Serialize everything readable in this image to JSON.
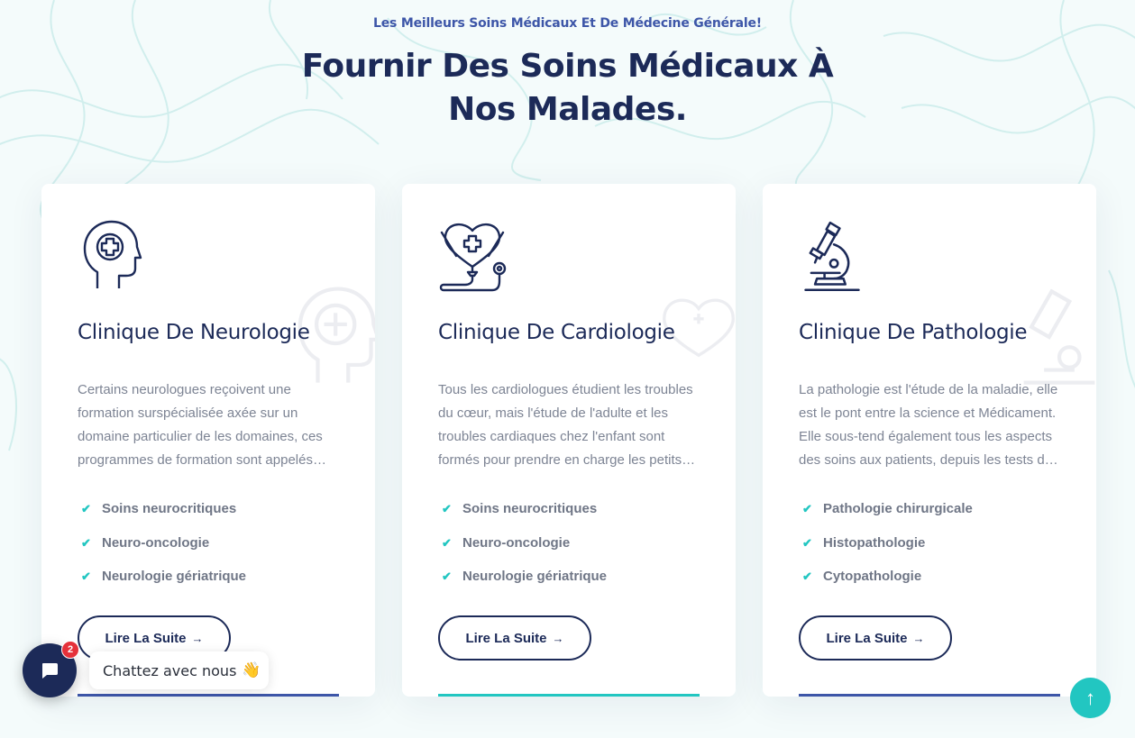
{
  "header": {
    "eyebrow": "Les Meilleurs Soins Médicaux Et De Médecine Générale!",
    "title_line1": "Fournir Des Soins Médicaux À",
    "title_line2": "Nos Malades."
  },
  "cards": [
    {
      "icon": "brain-head-icon",
      "title": "Clinique De Neurologie",
      "description": "Certains neurologues reçoivent une formation surspécialisée axée sur un domaine particulier de les domaines, ces programmes de formation sont appelés…",
      "features": [
        "Soins neurocritiques",
        "Neuro-oncologie",
        "Neurologie gériatrique"
      ],
      "button_label": "Lire La Suite",
      "accent_color": "#3d56a8"
    },
    {
      "icon": "heart-stethoscope-icon",
      "title": "Clinique De Cardiologie",
      "description": "Tous les cardiologues étudient les troubles du cœur, mais l'étude de l'adulte et les troubles cardiaques chez l'enfant sont formés pour prendre en charge les petits…",
      "features": [
        "Soins neurocritiques",
        "Neuro-oncologie",
        "Neurologie gériatrique"
      ],
      "button_label": "Lire La Suite",
      "accent_color": "#22c6c1"
    },
    {
      "icon": "microscope-icon",
      "title": "Clinique De Pathologie",
      "description": "La pathologie est l'étude de la maladie, elle est le pont entre la science et Médicament. Elle sous-tend également tous les aspects des soins aux patients, depuis les tests d…",
      "features": [
        "Pathologie chirurgicale",
        "Histopathologie",
        "Cytopathologie"
      ],
      "button_label": "Lire La Suite",
      "accent_color": "#3d56a8"
    }
  ],
  "chat": {
    "label": "Chattez avec nous",
    "emoji": "👋",
    "badge_count": "2"
  },
  "colors": {
    "navy": "#1c2a58",
    "teal": "#22c6c1",
    "blue": "#3d56a8",
    "badge_red": "#e5313a"
  }
}
